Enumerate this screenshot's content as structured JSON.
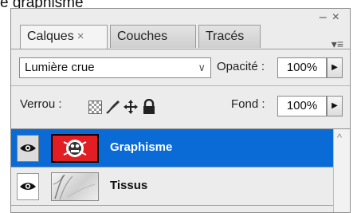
{
  "caption": "e graphisme",
  "panel": {
    "window_controls": [
      "–",
      "×"
    ],
    "tabs": [
      {
        "label": "Calques",
        "close": "×",
        "active": true
      },
      {
        "label": "Couches",
        "active": false
      },
      {
        "label": "Tracés",
        "active": false
      }
    ],
    "menu_icon": "▾≡"
  },
  "blend_mode": {
    "value": "Lumière crue",
    "chevron": "∨"
  },
  "opacity": {
    "label": "Opacité :",
    "value": "100%",
    "arrow": "▶"
  },
  "lock": {
    "label": "Verrou :",
    "icons": [
      "lock-transparent-pixels-icon",
      "lock-image-pixels-icon",
      "lock-position-icon",
      "lock-all-icon"
    ]
  },
  "fill": {
    "label": "Fond :",
    "value": "100%",
    "arrow": "▶"
  },
  "layers": [
    {
      "name": "Graphisme",
      "selected": true
    },
    {
      "name": "Tissus",
      "selected": false
    }
  ],
  "colors": {
    "selection": "#0a6ad6",
    "graphisme_thumb": "#e21d24"
  }
}
